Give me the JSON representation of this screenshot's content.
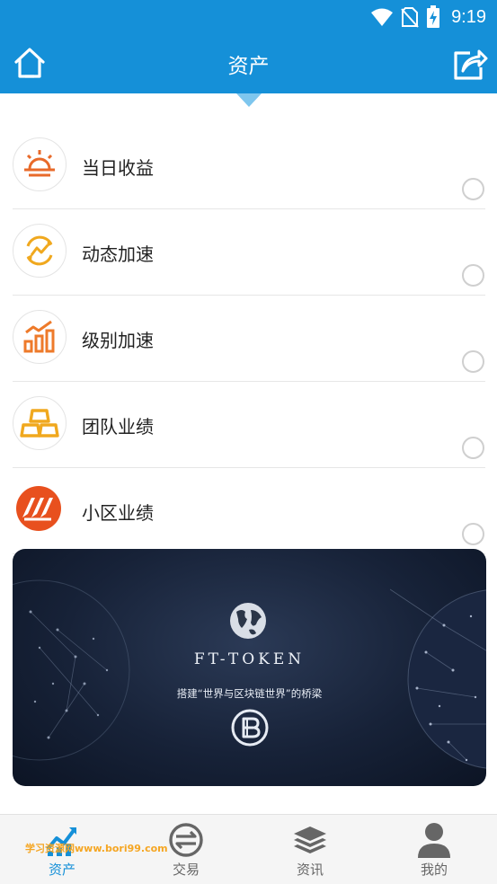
{
  "status_bar": {
    "time": "9:19"
  },
  "header": {
    "title": "资产"
  },
  "list": [
    {
      "label": "当日收益",
      "icon": "sunrise-icon",
      "color": "#e86a2a"
    },
    {
      "label": "动态加速",
      "icon": "refresh-chart-icon",
      "color": "#f0a81e"
    },
    {
      "label": "级别加速",
      "icon": "bar-chart-icon",
      "color": "#ee7a2a"
    },
    {
      "label": "团队业绩",
      "icon": "gold-bars-icon",
      "color": "#f0a81e"
    },
    {
      "label": "小区业绩",
      "icon": "stripes-logo-icon",
      "color": "#e8501e"
    }
  ],
  "banner": {
    "brand": "FT-TOKEN",
    "tagline": "搭建“世界与区块链世界”的桥梁"
  },
  "tabs": [
    {
      "label": "资产",
      "icon": "chart-icon",
      "active": true
    },
    {
      "label": "交易",
      "icon": "exchange-icon",
      "active": false
    },
    {
      "label": "资讯",
      "icon": "layers-icon",
      "active": false
    },
    {
      "label": "我的",
      "icon": "user-icon",
      "active": false
    }
  ],
  "watermark": "学习资源网www.bori99.com",
  "colors": {
    "primary": "#1590d8",
    "active_tab": "#1590d8"
  }
}
